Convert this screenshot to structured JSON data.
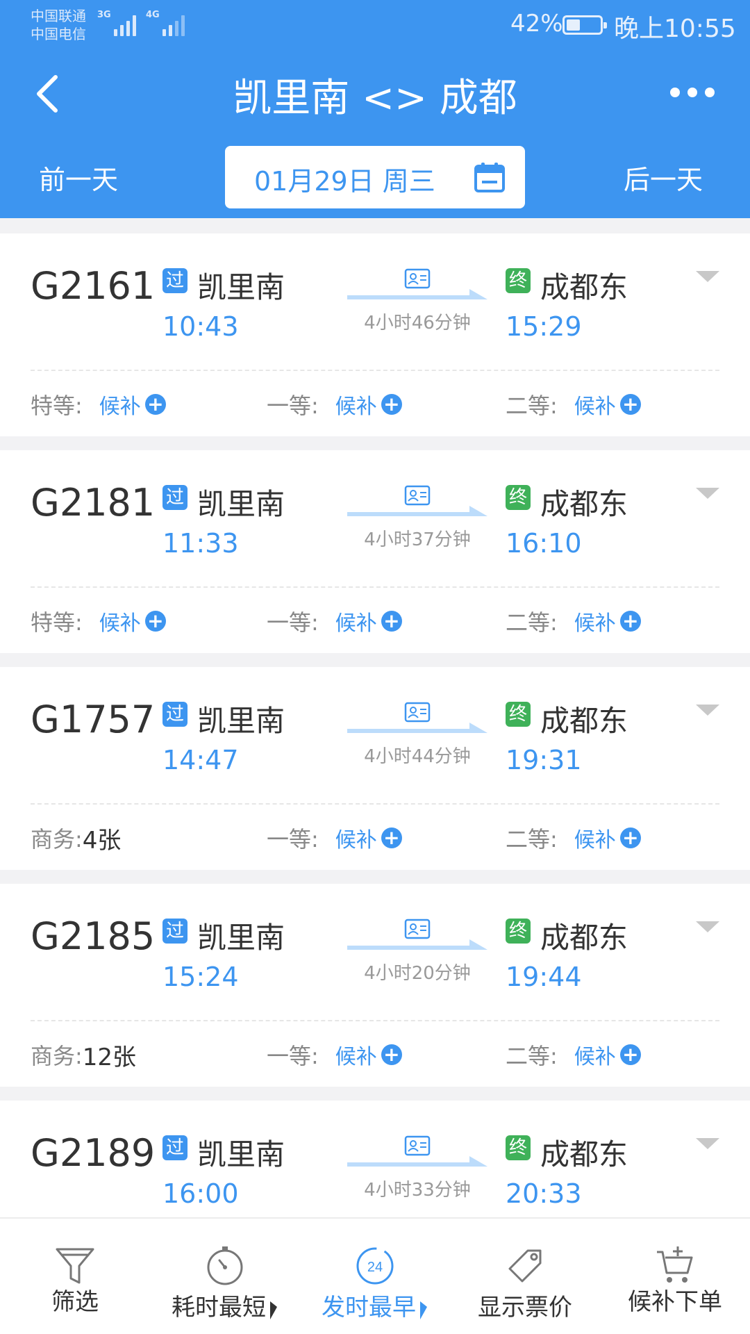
{
  "status_bar": {
    "carrier1": "中国联通",
    "carrier2": "中国电信",
    "net1": "3G",
    "net2": "4G",
    "battery": "42%",
    "battery_level": 0.42,
    "time": "晚上10:55"
  },
  "header": {
    "title": "凯里南 <> 成都",
    "prev_day": "前一天",
    "next_day": "后一天",
    "date": "01月29日 周三"
  },
  "trains": [
    {
      "no": "G2161",
      "pass_tag": "过",
      "from": "凯里南",
      "dep": "10:43",
      "duration": "4小时46分钟",
      "end_tag": "终",
      "to": "成都东",
      "arr": "15:29",
      "seats": [
        {
          "label": "特等:",
          "value": "候补",
          "plus": true
        },
        {
          "label": "一等:",
          "value": "候补",
          "plus": true
        },
        {
          "label": "二等:",
          "value": "候补",
          "plus": true
        }
      ]
    },
    {
      "no": "G2181",
      "pass_tag": "过",
      "from": "凯里南",
      "dep": "11:33",
      "duration": "4小时37分钟",
      "end_tag": "终",
      "to": "成都东",
      "arr": "16:10",
      "seats": [
        {
          "label": "特等:",
          "value": "候补",
          "plus": true
        },
        {
          "label": "一等:",
          "value": "候补",
          "plus": true
        },
        {
          "label": "二等:",
          "value": "候补",
          "plus": true
        }
      ]
    },
    {
      "no": "G1757",
      "pass_tag": "过",
      "from": "凯里南",
      "dep": "14:47",
      "duration": "4小时44分钟",
      "end_tag": "终",
      "to": "成都东",
      "arr": "19:31",
      "seats": [
        {
          "label": "商务:",
          "value": "4张",
          "plus": false
        },
        {
          "label": "一等:",
          "value": "候补",
          "plus": true
        },
        {
          "label": "二等:",
          "value": "候补",
          "plus": true
        }
      ]
    },
    {
      "no": "G2185",
      "pass_tag": "过",
      "from": "凯里南",
      "dep": "15:24",
      "duration": "4小时20分钟",
      "end_tag": "终",
      "to": "成都东",
      "arr": "19:44",
      "seats": [
        {
          "label": "商务:",
          "value": "12张",
          "plus": false
        },
        {
          "label": "一等:",
          "value": "候补",
          "plus": true
        },
        {
          "label": "二等:",
          "value": "候补",
          "plus": true
        }
      ]
    },
    {
      "no": "G2189",
      "pass_tag": "过",
      "from": "凯里南",
      "dep": "16:00",
      "duration": "4小时33分钟",
      "end_tag": "终",
      "to": "成都东",
      "arr": "20:33",
      "seats": []
    }
  ],
  "tabbar": {
    "filter": "筛选",
    "shortest": "耗时最短",
    "earliest": "发时最早",
    "earliest_icon_text": "24",
    "show_price": "显示票价",
    "waitlist": "候补下单",
    "active": "earliest"
  },
  "icons": {
    "back": "back-arrow-icon",
    "more": "more-dots-icon",
    "calendar": "calendar-icon",
    "id_card": "id-card-icon",
    "expand": "caret-down-icon",
    "filter": "funnel-icon",
    "timer": "stopwatch-icon",
    "clock24": "clock-24-icon",
    "price": "price-tag-icon",
    "cart": "cart-plus-icon"
  },
  "colors": {
    "primary": "#3d95f0",
    "end_tag": "#3fb159",
    "background": "#f2f2f4"
  }
}
